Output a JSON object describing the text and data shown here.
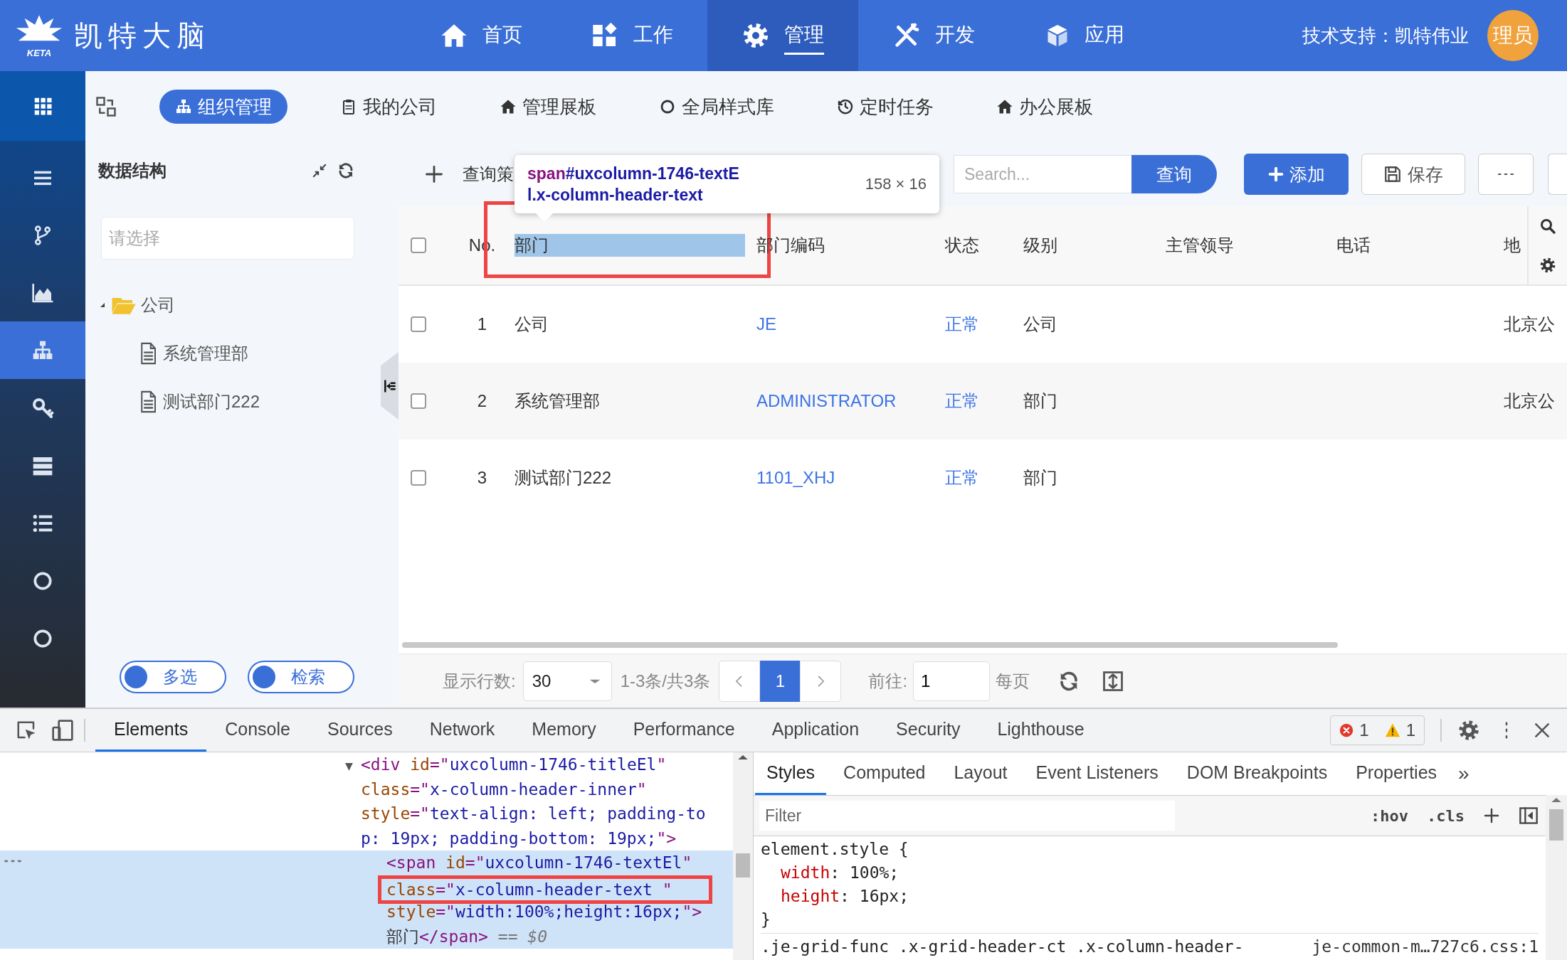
{
  "header": {
    "logo_mark": "KETA",
    "logo_text": "凯特大脑",
    "nav": [
      {
        "label": "首页",
        "selected": false
      },
      {
        "label": "工作",
        "selected": false
      },
      {
        "label": "管理",
        "selected": true
      },
      {
        "label": "开发",
        "selected": false
      },
      {
        "label": "应用",
        "selected": false
      }
    ],
    "support": "技术支持：凯特伟业",
    "avatar": "理员"
  },
  "rail": [
    {
      "selected": false
    },
    {
      "selected": false
    },
    {
      "selected": false
    },
    {
      "selected": true
    },
    {
      "selected": false
    },
    {
      "selected": false
    },
    {
      "selected": false
    },
    {
      "selected": false
    },
    {
      "selected": false
    }
  ],
  "tabs": [
    {
      "label": "组织管理",
      "selected": true
    },
    {
      "label": "我的公司",
      "selected": false
    },
    {
      "label": "管理展板",
      "selected": false
    },
    {
      "label": "全局样式库",
      "selected": false
    },
    {
      "label": "定时任务",
      "selected": false
    },
    {
      "label": "办公展板",
      "selected": false
    }
  ],
  "tree_panel": {
    "title": "数据结构",
    "placeholder": "请选择",
    "tree": [
      {
        "label": "公司",
        "expanded": true,
        "children": [
          {
            "label": "系统管理部"
          },
          {
            "label": "测试部门222"
          }
        ]
      }
    ],
    "toggles": [
      {
        "label": "多选",
        "on": false
      },
      {
        "label": "检索",
        "on": false
      }
    ]
  },
  "toolbar": {
    "query_label": "查询策",
    "search_placeholder": "Search...",
    "search_button": "查询",
    "buttons": [
      {
        "label": "添加",
        "kind": "primary"
      },
      {
        "label": "保存",
        "kind": "save"
      }
    ]
  },
  "inspect_tooltip": {
    "tag": "span",
    "selector": "#uxcolumn-1746-textEl.x-column-header-text",
    "size": "158 × 16"
  },
  "grid": {
    "header_checked": false,
    "columns": [
      {
        "label": "No.",
        "kind": "index",
        "highlighted": false,
        "framed": false
      },
      {
        "label": "部门",
        "kind": "text",
        "highlighted": true,
        "framed": true
      },
      {
        "label": "部门编码",
        "kind": "link",
        "highlighted": false,
        "framed": false
      },
      {
        "label": "状态",
        "kind": "link",
        "highlighted": false,
        "framed": false
      },
      {
        "label": "级别",
        "kind": "text",
        "highlighted": false,
        "framed": false
      },
      {
        "label": "主管领导",
        "kind": "text",
        "highlighted": false,
        "framed": false
      },
      {
        "label": "电话",
        "kind": "text",
        "highlighted": false,
        "framed": false
      },
      {
        "label": "地",
        "kind": "text",
        "highlighted": false,
        "framed": false
      }
    ],
    "rows": [
      {
        "checked": false,
        "cells": [
          "1",
          "公司",
          "JE",
          "正常",
          "公司",
          null,
          null,
          "北京公"
        ]
      },
      {
        "checked": false,
        "cells": [
          "2",
          "系统管理部",
          "ADMINISTRATOR",
          "正常",
          "部门",
          null,
          null,
          "北京公"
        ]
      },
      {
        "checked": false,
        "cells": [
          "3",
          "测试部门222",
          "1101_XHJ",
          "正常",
          "部门",
          null,
          null,
          null
        ]
      }
    ]
  },
  "pager": {
    "rows_label": "显示行数:",
    "page_size": "30",
    "range": "1-3条/共3条",
    "pages": [
      {
        "label": "1",
        "selected": true
      }
    ],
    "goto_label": "前往:",
    "goto_value": "1",
    "per_page": "每页"
  },
  "devtools": {
    "tabs": [
      {
        "label": "Elements",
        "selected": true
      },
      {
        "label": "Console",
        "selected": false
      },
      {
        "label": "Sources",
        "selected": false
      },
      {
        "label": "Network",
        "selected": false
      },
      {
        "label": "Memory",
        "selected": false
      },
      {
        "label": "Performance",
        "selected": false
      },
      {
        "label": "Application",
        "selected": false
      },
      {
        "label": "Security",
        "selected": false
      },
      {
        "label": "Lighthouse",
        "selected": false
      }
    ],
    "errors": "1",
    "warnings": "1",
    "dom": {
      "expander": "▼",
      "selected": false,
      "lines": [
        {
          "framed": false,
          "tokens": [
            {
              "kind": "punct",
              "text": "<"
            },
            {
              "kind": "tag",
              "text": "div"
            },
            {
              "kind": "attr",
              "text": " id"
            },
            {
              "kind": "punct",
              "text": "=\""
            },
            {
              "kind": "value",
              "text": "uxcolumn-1746-titleEl"
            },
            {
              "kind": "punct",
              "text": "\""
            }
          ]
        },
        {
          "framed": false,
          "tokens": [
            {
              "kind": "attr",
              "text": "class"
            },
            {
              "kind": "punct",
              "text": "=\""
            },
            {
              "kind": "value",
              "text": "x-column-header-inner"
            },
            {
              "kind": "punct",
              "text": "\""
            }
          ]
        },
        {
          "framed": false,
          "tokens": [
            {
              "kind": "attr",
              "text": "style"
            },
            {
              "kind": "punct",
              "text": "=\""
            },
            {
              "kind": "value",
              "text": "text-align: left; padding-to"
            }
          ]
        },
        {
          "framed": false,
          "tokens": [
            {
              "kind": "value",
              "text": "p: 19px; padding-bottom: 19px;"
            },
            {
              "kind": "punct",
              "text": "\">"
            }
          ]
        }
      ],
      "children": [
        {
          "selected": true,
          "lines": [
            {
              "framed": false,
              "tokens": [
                {
                  "kind": "punct",
                  "text": "<"
                },
                {
                  "kind": "tag",
                  "text": "span"
                },
                {
                  "kind": "attr",
                  "text": " id"
                },
                {
                  "kind": "punct",
                  "text": "=\""
                },
                {
                  "kind": "value",
                  "text": "uxcolumn-1746-textEl"
                },
                {
                  "kind": "punct",
                  "text": "\""
                }
              ]
            },
            {
              "framed": true,
              "tokens": [
                {
                  "kind": "attr",
                  "text": "class"
                },
                {
                  "kind": "punct",
                  "text": "=\""
                },
                {
                  "kind": "value",
                  "text": "x-column-header-text "
                },
                {
                  "kind": "punct",
                  "text": "\""
                }
              ]
            },
            {
              "framed": false,
              "tokens": [
                {
                  "kind": "attr",
                  "text": "style"
                },
                {
                  "kind": "punct",
                  "text": "=\""
                },
                {
                  "kind": "value",
                  "text": "width:100%;height:16px;"
                },
                {
                  "kind": "punct",
                  "text": "\">"
                }
              ]
            },
            {
              "framed": false,
              "tokens": [
                {
                  "kind": "text",
                  "text": "部门"
                },
                {
                  "kind": "punct",
                  "text": "</"
                },
                {
                  "kind": "tag",
                  "text": "span"
                },
                {
                  "kind": "punct",
                  "text": ">"
                },
                {
                  "kind": "note",
                  "text": " == $0"
                }
              ]
            }
          ]
        }
      ]
    },
    "side_tabs": [
      {
        "label": "Styles",
        "selected": true
      },
      {
        "label": "Computed",
        "selected": false
      },
      {
        "label": "Layout",
        "selected": false
      },
      {
        "label": "Event Listeners",
        "selected": false
      },
      {
        "label": "DOM Breakpoints",
        "selected": false
      },
      {
        "label": "Properties",
        "selected": false
      }
    ],
    "more_tabs": "»",
    "filter_placeholder": "Filter",
    "style_buttons": [
      ":hov",
      ".cls"
    ],
    "rules": [
      {
        "selector": "element.style {",
        "props": [
          {
            "name": "width",
            "value": ": 100%;"
          },
          {
            "name": "height",
            "value": ": 16px;"
          }
        ],
        "close": "}"
      },
      {
        "selector": ".je-grid-func .x-grid-header-ct .x-column-header-",
        "source": "je-common-m…727c6.css:1"
      }
    ]
  }
}
